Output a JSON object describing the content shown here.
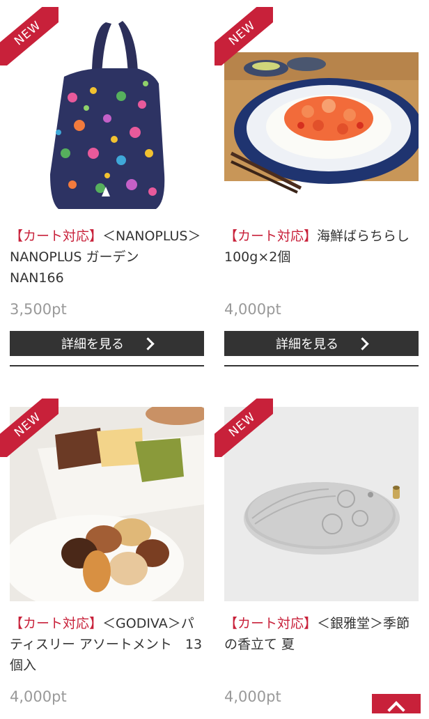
{
  "badge_label": "NEW",
  "colors": {
    "accent": "#c8213a",
    "button_bg": "#333333",
    "price": "#999999",
    "text": "#333333"
  },
  "products": [
    {
      "tag": "【カート対応】",
      "name": "＜NANOPLUS＞NANOPLUS ガーデン　NAN166",
      "price": "3,500pt",
      "button_label": "詳細を見る",
      "image": "floral-tote-bag"
    },
    {
      "tag": "【カート対応】",
      "name": "海鮮ばらちらし　100g×2個",
      "price": "4,000pt",
      "button_label": "詳細を見る",
      "image": "seafood-chirashi-bowl"
    },
    {
      "tag": "【カート対応】",
      "name": "＜GODIVA＞パティスリー アソートメント　13個入",
      "price": "4,000pt",
      "image": "godiva-pastry-assortment"
    },
    {
      "tag": "【カート対応】",
      "name": "＜銀雅堂＞季節の香立て 夏",
      "price": "4,000pt",
      "image": "silver-incense-plate"
    }
  ],
  "page_top_icon": "chevron-up-icon"
}
